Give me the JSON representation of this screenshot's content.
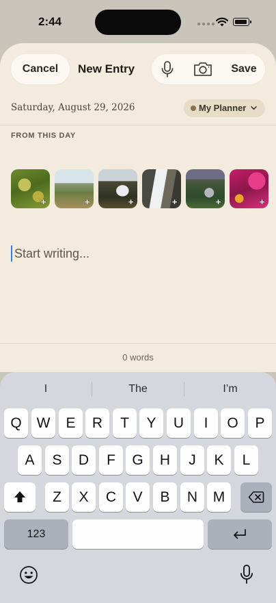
{
  "status_bar": {
    "time": "2:44"
  },
  "header": {
    "cancel_label": "Cancel",
    "title": "New Entry",
    "save_label": "Save",
    "icons": [
      "microphone-icon",
      "camera-icon"
    ]
  },
  "entry": {
    "date": "Saturday, August 29, 2026",
    "planner": "My Planner"
  },
  "from_this_day": {
    "label": "FROM THIS DAY",
    "photos": [
      {
        "name": "photo-lemon-tree",
        "badge": "+"
      },
      {
        "name": "photo-valley-road",
        "badge": "+"
      },
      {
        "name": "photo-waterfall-cliff",
        "badge": "+"
      },
      {
        "name": "photo-waterfall-closeup",
        "badge": "+"
      },
      {
        "name": "photo-waterfall-distant",
        "badge": "+"
      },
      {
        "name": "photo-pink-flowers",
        "badge": "+"
      }
    ]
  },
  "editor": {
    "placeholder": "Start writing..."
  },
  "footer": {
    "word_count": "0 words"
  },
  "keyboard": {
    "suggestions": [
      "I",
      "The",
      "I’m"
    ],
    "row1": [
      "Q",
      "W",
      "E",
      "R",
      "T",
      "Y",
      "U",
      "I",
      "O",
      "P"
    ],
    "row2": [
      "A",
      "S",
      "D",
      "F",
      "G",
      "H",
      "J",
      "K",
      "L"
    ],
    "row3": [
      "Z",
      "X",
      "C",
      "V",
      "B",
      "N",
      "M"
    ],
    "numbers_key": "123",
    "space_key": "",
    "icons": [
      "shift-icon",
      "delete-icon",
      "return-icon",
      "emoji-icon",
      "dictation-icon"
    ]
  },
  "colors": {
    "sheet_bg": "#f2ebde",
    "planner_chip": "#e7dcc8",
    "cursor": "#3d7bd9",
    "keyboard_bg": "#d4d7de"
  }
}
